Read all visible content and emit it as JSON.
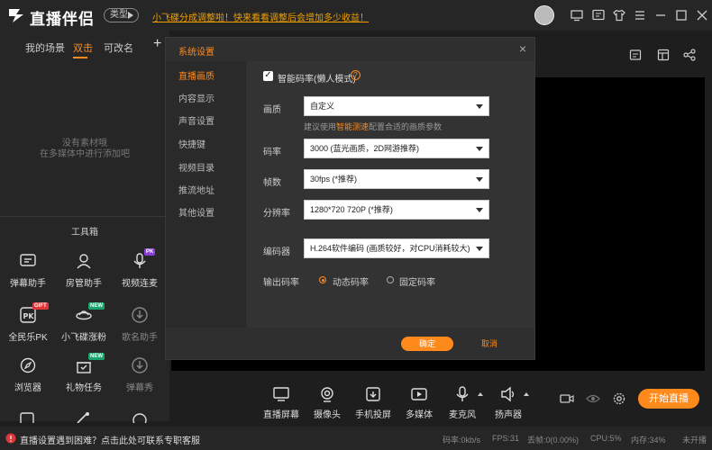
{
  "app": {
    "title": "直播伴侣",
    "type_label": "类型",
    "notice": "小飞碟分成调整啦！快来看看调整后会增加多少收益！"
  },
  "scenes": {
    "tabs": [
      "我的场景",
      "双击",
      "可改名"
    ],
    "add": "+",
    "empty_line1": "没有素材哦",
    "empty_line2": "在多媒体中进行添加吧"
  },
  "toolbox": {
    "title": "工具箱",
    "items": [
      {
        "label": "弹幕助手",
        "icon": "danmaku-icon"
      },
      {
        "label": "房管助手",
        "icon": "room-manager-icon"
      },
      {
        "label": "视频连麦",
        "icon": "mic-link-icon",
        "badge": "PK"
      },
      {
        "label": "全民乐PK",
        "icon": "pk-icon",
        "badge": "GIFT"
      },
      {
        "label": "小飞碟涨粉",
        "icon": "ufo-icon",
        "badge": "NEW"
      },
      {
        "label": "歌名助手",
        "icon": "download-icon"
      },
      {
        "label": "浏览器",
        "icon": "browser-icon"
      },
      {
        "label": "礼物任务",
        "icon": "gift-task-icon",
        "badge": "NEW"
      },
      {
        "label": "弹幕秀",
        "icon": "danmaku-show-icon"
      }
    ]
  },
  "controls": [
    {
      "label": "直播屏幕",
      "icon": "screen-icon"
    },
    {
      "label": "摄像头",
      "icon": "camera-icon"
    },
    {
      "label": "手机投屏",
      "icon": "phone-cast-icon"
    },
    {
      "label": "多媒体",
      "icon": "media-icon"
    },
    {
      "label": "麦克风",
      "icon": "microphone-icon"
    },
    {
      "label": "扬声器",
      "icon": "speaker-icon"
    }
  ],
  "start_button": "开始直播",
  "status": {
    "help": "直播设置遇到困难？点击此处可联系专职客服",
    "bitrate": "码率:0kb/s",
    "fps": "FPS:31",
    "dropped": "丢帧:0(0.00%)",
    "cpu": "CPU:5%",
    "memory": "内存:34%",
    "state": "未开播"
  },
  "dialog": {
    "title": "系统设置",
    "close": "×",
    "nav": [
      "直播画质",
      "内容显示",
      "声音设置",
      "快捷键",
      "视频目录",
      "推流地址",
      "其他设置"
    ],
    "smart_bitrate_label": "智能码率(懒人模式)",
    "smart_bitrate_checked": "✓",
    "help_mark": "?",
    "quality_label": "画质",
    "quality_value": "自定义",
    "hint_prefix": "建议使用",
    "hint_link": "智能测速",
    "hint_suffix": "配置合适的画质参数",
    "bitrate_label": "码率",
    "bitrate_value": "3000 (蓝光画质，2D网游推荐)",
    "fps_label": "帧数",
    "fps_value": "30fps (*推荐)",
    "resolution_label": "分辨率",
    "resolution_value": "1280*720 720P (*推荐)",
    "encoder_label": "编码器",
    "encoder_value": "H.264软件编码 (画质较好，对CPU消耗较大)",
    "output_bitrate_label": "输出码率",
    "dynamic_label": "动态码率",
    "fixed_label": "固定码率",
    "ok": "确定",
    "cancel": "取消"
  },
  "colors": {
    "accent": "#ff8a1c",
    "background": "#1e1e1e",
    "panel": "#262626"
  }
}
